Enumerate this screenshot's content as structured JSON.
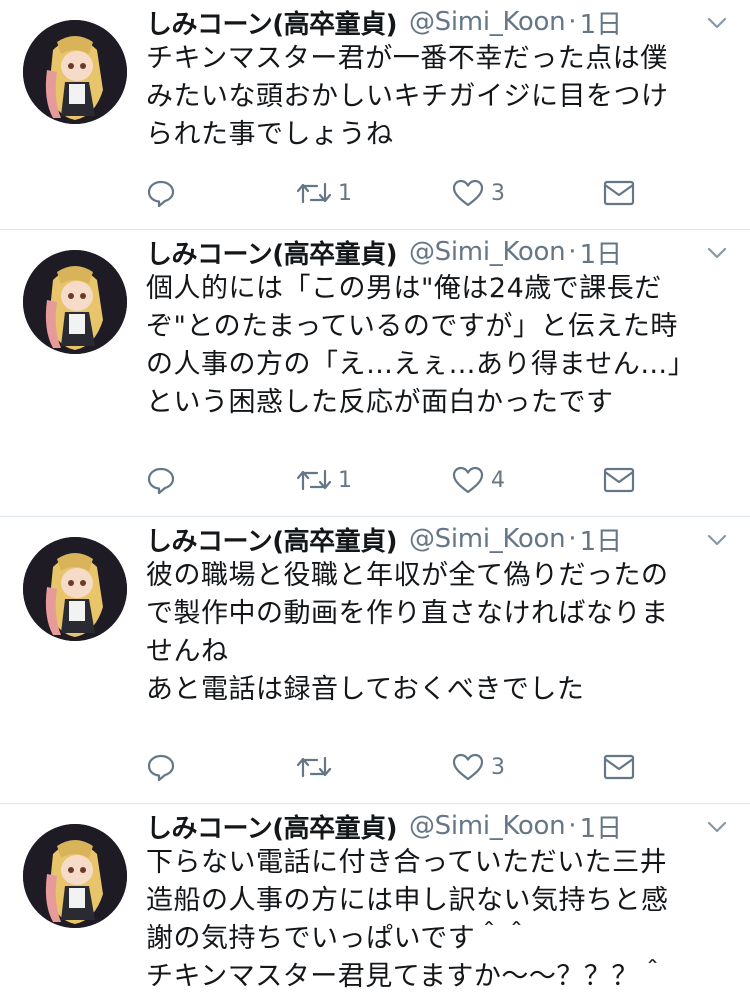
{
  "tweets": [
    {
      "name": "しみコーン(高卒童貞)",
      "handle": "@Simi_Koon",
      "time": "1日",
      "lines": [
        "チキンマスター君が一番不幸だった点は僕",
        "みたいな頭おかしいキチガイジに目をつけ",
        "られた事でしょうね"
      ],
      "retweets": "1",
      "likes": "3"
    },
    {
      "name": "しみコーン(高卒童貞)",
      "handle": "@Simi_Koon",
      "time": "1日",
      "lines": [
        "個人的には「この男は\"俺は24歳で課長だ",
        "ぞ\"とのたまっているのですが」と伝えた時",
        "の人事の方の「え…えぇ…あり得ません…」",
        "という困惑した反応が面白かったです"
      ],
      "retweets": "1",
      "likes": "4"
    },
    {
      "name": "しみコーン(高卒童貞)",
      "handle": "@Simi_Koon",
      "time": "1日",
      "lines": [
        "彼の職場と役職と年収が全て偽りだったの",
        "で製作中の動画を作り直さなければなりま",
        "せんね",
        "あと電話は録音しておくべきでした"
      ],
      "retweets": "",
      "likes": "3"
    },
    {
      "name": "しみコーン(高卒童貞)",
      "handle": "@Simi_Koon",
      "time": "1日",
      "lines": [
        "下らない電話に付き合っていただいた三井",
        "造船の人事の方には申し訳ない気持ちと感",
        "謝の気持ちでいっぱいです＾＾",
        "チキンマスター君見てますか〜〜？？？＾"
      ],
      "retweets": "",
      "likes": ""
    }
  ],
  "icons": {
    "reply": "reply-icon",
    "retweet": "retweet-icon",
    "like": "heart-icon",
    "dm": "envelope-icon",
    "caret": "chevron-down-icon"
  },
  "colors": {
    "text": "#14171a",
    "secondary": "#657786",
    "divider": "#e1e8ed"
  }
}
